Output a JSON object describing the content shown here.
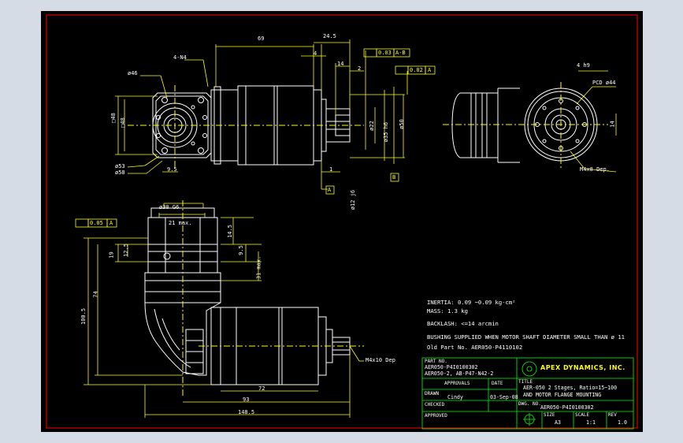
{
  "colors": {
    "background": "#000000",
    "outer": "#d5dce5",
    "line": "#ffffff",
    "dimension": "#ffff00",
    "frame": "#ff0000",
    "titleblock": "#00ff00"
  },
  "dimensions": {
    "d69": "69",
    "d245": "24.5",
    "d4": "4",
    "d14": "14",
    "d2": "2",
    "d1": "1",
    "n4": "4-N4",
    "phi46": "ø46",
    "sq4": "□48",
    "sq48": "□48",
    "phi53": "ø53",
    "phi58": "ø58",
    "d95a": "9.5",
    "d22": "ø22",
    "d35": "ø35 h6",
    "d50": "ø50",
    "phi12": "ø12 j6",
    "tol_flat": "0.03",
    "tol_flat_ref": "A-B",
    "tol_perp": "0.02",
    "tol_perp_ref": "A",
    "datum_a": "A",
    "datum_b": "B",
    "keyway": "4 h9",
    "pcd": "PCD ø44",
    "d14b": "14",
    "m4x8": "M4x8 Dep.",
    "phi30": "ø30 G6",
    "d21": "21 max.",
    "d145": "14.5",
    "d95b": "9.5",
    "d19": "19",
    "d125": "12.5",
    "d31": "31 max.",
    "tol_par": "0.05",
    "tol_par_ref": "A",
    "d74": "74",
    "d1005": "100.5",
    "d72": "72",
    "d93": "93",
    "d1485": "148.5",
    "m4x10": "M4x10 Dep"
  },
  "notes": {
    "inertia": "INERTIA:  0.09 ~0.09  kg-cm²",
    "mass": "MASS:  1.3  kg",
    "backlash": "BACKLASH: <=14 arcmin",
    "bushing": "BUSHING SUPPLIED WHEN MOTOR SHAFT DIAMETER SMALL THAN ø 11",
    "old_part": "Old Part No. AER050-P4110102"
  },
  "titleblock": {
    "part_no_label": "PART NO.",
    "part_no_1": "AER050-P4I0100302",
    "part_no_2": "AER050-2, AB-P47-N42-2",
    "approvals": "APPROVALS",
    "date_label": "DATE",
    "drawn": "DRAWN",
    "drawn_by": "Cindy",
    "drawn_date": "03-Sep-08",
    "checked": "CHECKED",
    "approved": "APPROVED",
    "company": "APEX DYNAMICS, INC.",
    "title_label": "TITLE",
    "title_1": "AER-050 2 Stages, Ratio=15~100",
    "title_2": "AND MOTOR FLANGE MOUNTING",
    "dwg_label": "DWG. NO.",
    "dwg_no": "AER050-P4I0100302",
    "size_label": "SIZE",
    "size": "A3",
    "scale_label": "SCALE",
    "scale": "1:1",
    "rev_label": "REV",
    "rev": "1.0"
  }
}
